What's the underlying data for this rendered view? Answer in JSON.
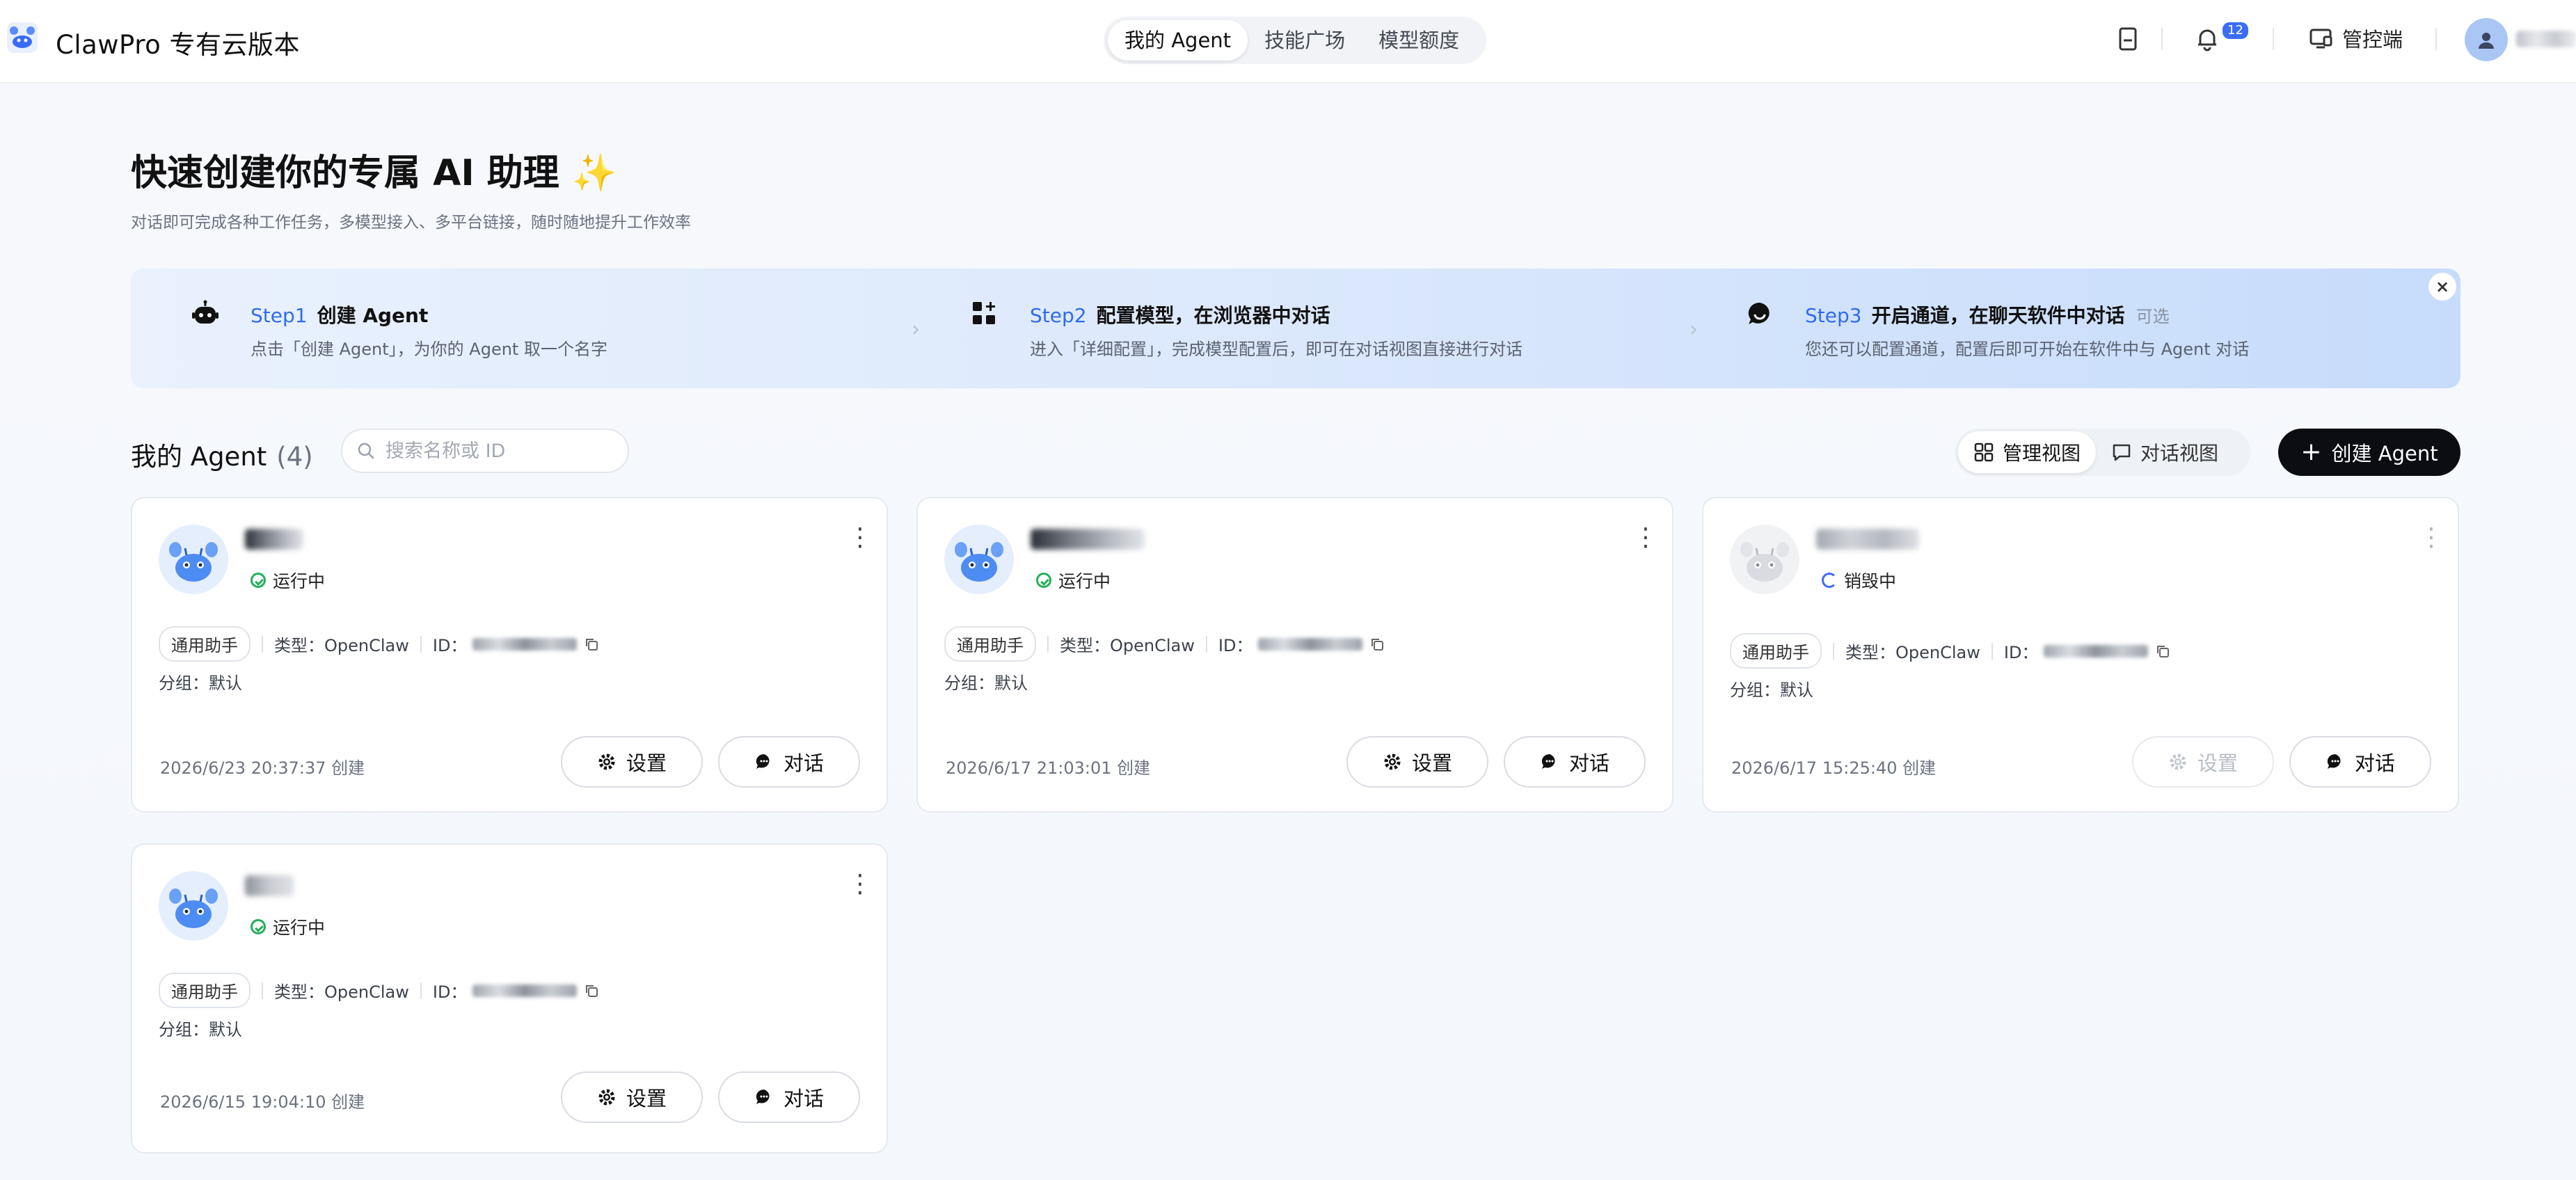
{
  "header": {
    "app_title": "ClawPro 专有云版本",
    "tabs": [
      {
        "label": "我的 Agent",
        "active": true
      },
      {
        "label": "技能广场",
        "active": false
      },
      {
        "label": "模型额度",
        "active": false
      }
    ],
    "notification_count": "12",
    "console_label": "管控端",
    "icons": [
      "doc-icon",
      "bell-icon",
      "monitor-icon",
      "user-avatar"
    ]
  },
  "hero": {
    "title": "快速创建你的专属 AI 助理",
    "sparkle": "✨",
    "subtitle": "对话即可完成各种工作任务，多模型接入、多平台链接，随时随地提升工作效率"
  },
  "steps": [
    {
      "num": "Step1",
      "title": "创建 Agent",
      "optional": "",
      "desc": "点击「创建 Agent」，为你的 Agent 取一个名字",
      "icon": "robot-icon"
    },
    {
      "num": "Step2",
      "title": "配置模型，在浏览器中对话",
      "optional": "",
      "desc": "进入「详细配置」，完成模型配置后，即可在对话视图直接进行对话",
      "icon": "grid-plus-icon"
    },
    {
      "num": "Step3",
      "title": "开启通道，在聊天软件中对话",
      "optional": "可选",
      "desc": "您还可以配置通道，配置后即可开始在软件中与 Agent 对话",
      "icon": "chat-bubble-icon"
    }
  ],
  "toolbar": {
    "section_title": "我的 Agent",
    "count": "(4)",
    "search_placeholder": "搜索名称或 ID",
    "manage_view": "管理视图",
    "chat_view": "对话视图",
    "create_label": "创建 Agent"
  },
  "agents": [
    {
      "status": "运行中",
      "status_kind": "running",
      "tag": "通用助手",
      "type": "类型：OpenClaw",
      "id_label": "ID：",
      "group": "分组：默认",
      "created": "2026/6/23 20:37:37 创建",
      "settings": "设置",
      "chat": "对话"
    },
    {
      "status": "运行中",
      "status_kind": "running",
      "tag": "通用助手",
      "type": "类型：OpenClaw",
      "id_label": "ID：",
      "group": "分组：默认",
      "created": "2026/6/17 21:03:01 创建",
      "settings": "设置",
      "chat": "对话"
    },
    {
      "status": "销毁中",
      "status_kind": "destroying",
      "tag": "通用助手",
      "type": "类型：OpenClaw",
      "id_label": "ID：",
      "group": "分组：默认",
      "created": "2026/6/17 15:25:40 创建",
      "settings": "设置",
      "chat": "对话"
    },
    {
      "status": "运行中",
      "status_kind": "running",
      "tag": "通用助手",
      "type": "类型：OpenClaw",
      "id_label": "ID：",
      "group": "分组：默认",
      "created": "2026/6/15 19:04:10 创建",
      "settings": "设置",
      "chat": "对话"
    }
  ],
  "colors": {
    "accent": "#2f6bf2",
    "running": "#22b05a",
    "destroying": "#3b6cf6",
    "primary_button": "#0b0d12"
  }
}
